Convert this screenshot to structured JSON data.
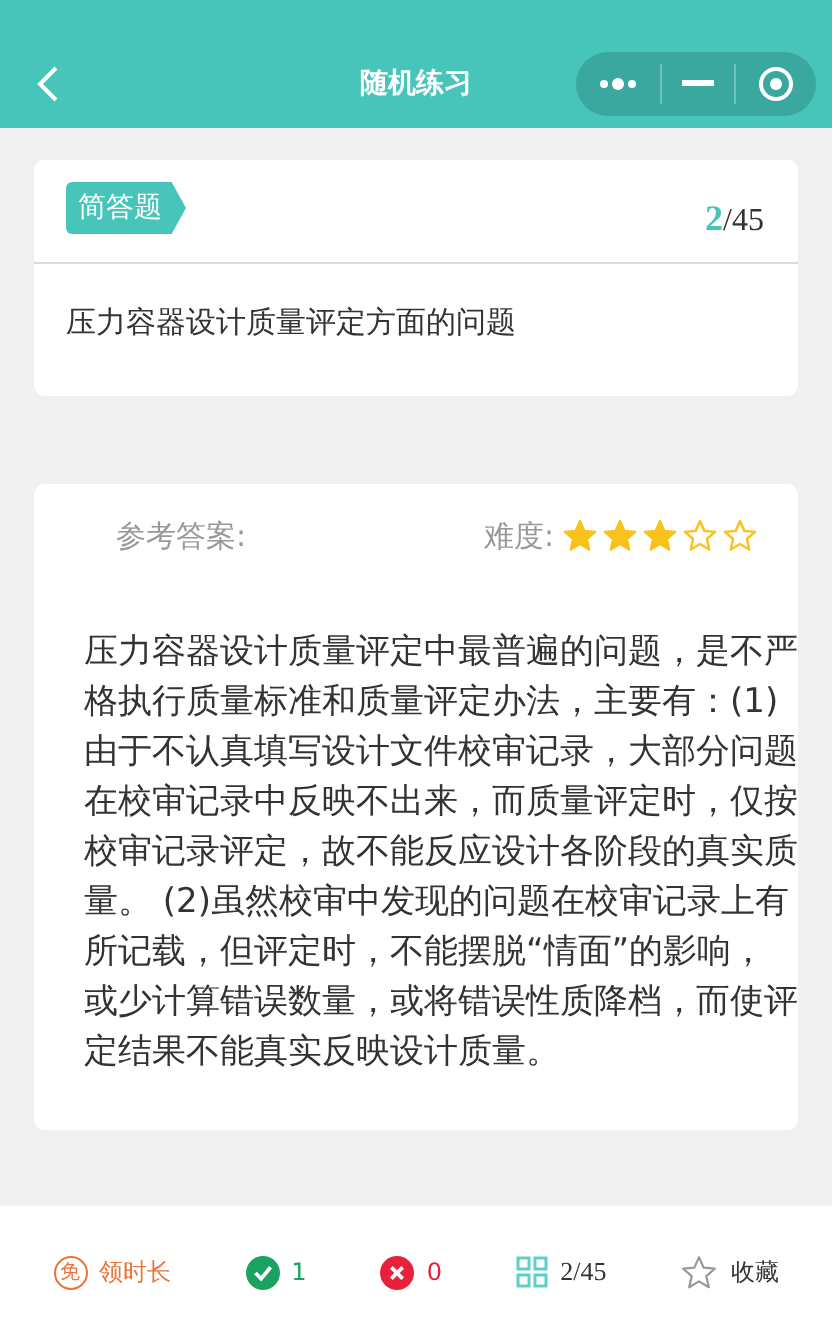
{
  "nav": {
    "title": "随机练习"
  },
  "question": {
    "type_tag": "简答题",
    "current": "2",
    "total": "/45",
    "text": "压力容器设计质量评定方面的问题"
  },
  "answer": {
    "label": "参考答案:",
    "difficulty_label": "难度:",
    "stars": 3,
    "text": "压力容器设计质量评定中最普遍的问题，是不严格执行质量标准和质量评定办法，主要有：(1)由于不认真填写设计文件校审记录，大部分问题在校审记录中反映不出来，而质量评定时，仅按校审记录评定，故不能反应设计各阶段的真实质量。 (2)虽然校审中发现的问题在校审记录上有所记载，但评定时，不能摆脱“情面”的影响，或少计算错误数量，或将错误性质降档，而使评定结果不能真实反映设计质量。"
  },
  "bottom_bar": [
    {
      "kind": "badge",
      "icon_text": "免",
      "label": "领时长"
    },
    {
      "kind": "correct",
      "label": "1"
    },
    {
      "kind": "wrong",
      "label": "0"
    },
    {
      "kind": "grid",
      "label": "2/45"
    },
    {
      "kind": "favorite",
      "label": "收藏"
    }
  ]
}
